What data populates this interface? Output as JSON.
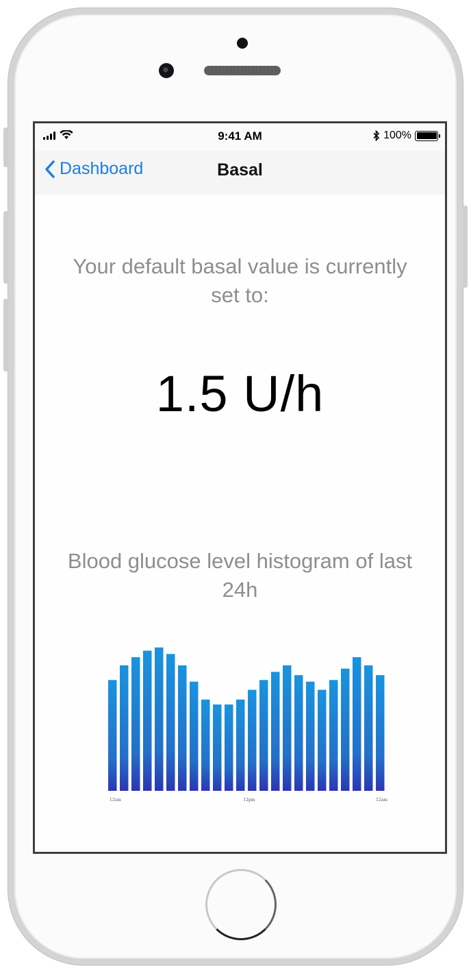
{
  "status_bar": {
    "time": "9:41 AM",
    "battery": "100%",
    "icons": [
      "signal-icon",
      "wifi-icon",
      "bluetooth-icon",
      "battery-icon"
    ]
  },
  "nav": {
    "back_label": "Dashboard",
    "title": "Basal"
  },
  "basal": {
    "intro": "Your default basal value is currently set to:",
    "value": "1.5 U/h"
  },
  "histogram": {
    "title": "Blood glucose level histogram of last 24h"
  },
  "colors": {
    "accent": "#1b7fe0",
    "bar_top": "#1a93df",
    "bar_bottom": "#2b36b4",
    "secondary_text": "#8e8e8e"
  },
  "chart_data": {
    "type": "bar",
    "categories": [
      "12am",
      "",
      "",
      "",
      "",
      "",
      "",
      "",
      "",
      "",
      "",
      "",
      "12pm",
      "",
      "",
      "",
      "",
      "",
      "",
      "",
      "",
      "",
      "",
      "",
      "12am"
    ],
    "values": [
      68,
      77,
      82,
      86,
      88,
      84,
      77,
      67,
      56,
      53,
      53,
      56,
      62,
      68,
      73,
      77,
      71,
      67,
      62,
      68,
      75,
      82,
      77,
      71
    ],
    "ylim": [
      0,
      90
    ],
    "tick_labels": [
      "12am",
      "12pm",
      "12am"
    ],
    "grid": false
  }
}
